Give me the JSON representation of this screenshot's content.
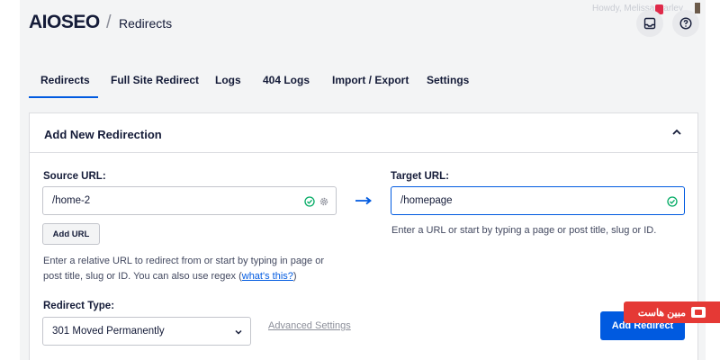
{
  "header": {
    "logo": "AIOSEO",
    "separator": "/",
    "breadcrumb": "Redirects",
    "greeting": "Howdy, Melissa Harley"
  },
  "tabs": [
    {
      "label": "Redirects",
      "active": true
    },
    {
      "label": "Full Site Redirect"
    },
    {
      "label": "Logs"
    },
    {
      "label": "404 Logs"
    },
    {
      "label": "Import / Export"
    },
    {
      "label": "Settings"
    }
  ],
  "panel": {
    "title": "Add New Redirection",
    "source": {
      "label": "Source URL:",
      "value": "/home-2",
      "add_url": "Add URL",
      "help_1": "Enter a relative URL to redirect from or start by typing in page or",
      "help_2": "post title, slug or ID. You can also use regex (",
      "help_link": "what's this?",
      "help_end": ")"
    },
    "target": {
      "label": "Target URL:",
      "value": "/homepage",
      "help": "Enter a URL or start by typing a page or post title, slug or ID."
    },
    "redirect_type": {
      "label": "Redirect Type:",
      "value": "301 Moved Permanently"
    },
    "advanced": "Advanced Settings",
    "submit": "Add Redirect"
  },
  "watermark": {
    "text": "مبین هاست"
  },
  "colors": {
    "accent": "#005ae0",
    "success": "#00aa63",
    "watermark": "#e53935"
  }
}
